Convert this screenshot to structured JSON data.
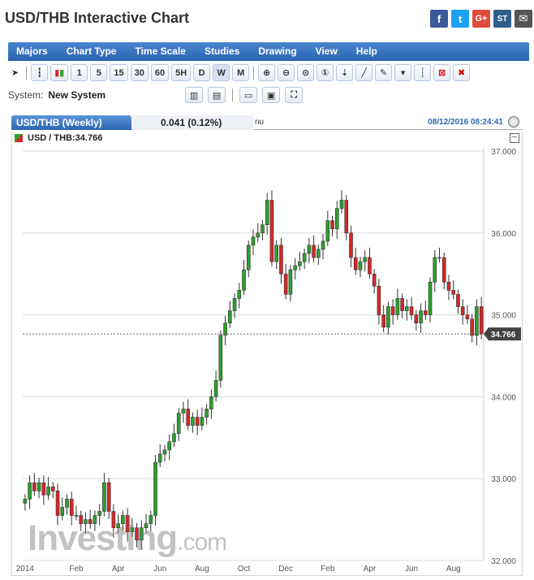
{
  "page": {
    "title": "USD/THB Interactive Chart",
    "share": [
      {
        "name": "facebook-icon",
        "glyph": "f",
        "cls": "fb"
      },
      {
        "name": "twitter-icon",
        "glyph": "t",
        "cls": "tw"
      },
      {
        "name": "google-plus-icon",
        "glyph": "G+",
        "cls": "gp"
      },
      {
        "name": "stocktwits-icon",
        "glyph": "ST",
        "cls": "st"
      },
      {
        "name": "mail-icon",
        "glyph": "✉",
        "cls": "ml"
      }
    ]
  },
  "menu": [
    "Majors",
    "Chart Type",
    "Time Scale",
    "Studies",
    "Drawing",
    "View",
    "Help"
  ],
  "toolbar": {
    "timeframes": [
      "1",
      "5",
      "15",
      "30",
      "60",
      "5H",
      "D",
      "W",
      "M"
    ],
    "active_timeframe": "W"
  },
  "system": {
    "label": "System:",
    "value": "New System"
  },
  "chart_header": {
    "tab": "USD/THB (Weekly)",
    "change": "0.041 (0.12%)",
    "extra": "nu",
    "timestamp": "08/12/2016 08:24:41",
    "legend": "USD / THB:34.766"
  },
  "watermark": {
    "brand": "Investing",
    "suffix": ".com"
  },
  "colors": {
    "up": "#2ca02c",
    "down": "#d62728",
    "grid": "#dcdcdc",
    "price_tag_bg": "#444444"
  },
  "chart_data": {
    "type": "candlestick",
    "title": "USD/THB (Weekly)",
    "ylim": [
      32.0,
      37.0
    ],
    "yticks": [
      "37.000",
      "36.000",
      "35.000",
      "34.000",
      "33.000",
      "32.000"
    ],
    "ytick_values": [
      37,
      36,
      35,
      34,
      33,
      32
    ],
    "xticks": [
      "2014",
      "Feb",
      "Apr",
      "Jun",
      "Aug",
      "Oct",
      "Dec",
      "Feb",
      "Apr",
      "Jun",
      "Aug"
    ],
    "xtick_index": [
      0,
      11,
      20,
      29,
      38,
      47,
      56,
      65,
      74,
      83,
      92
    ],
    "last_price": 34.766,
    "last_price_label": "34.766",
    "closes": [
      32.75,
      32.95,
      32.85,
      32.95,
      32.8,
      32.9,
      32.85,
      32.55,
      32.65,
      32.75,
      32.55,
      32.55,
      32.45,
      32.5,
      32.45,
      32.55,
      32.6,
      32.95,
      32.6,
      32.4,
      32.45,
      32.55,
      32.35,
      32.4,
      32.25,
      32.4,
      32.45,
      32.55,
      33.2,
      33.3,
      33.35,
      33.45,
      33.55,
      33.8,
      33.85,
      33.65,
      33.75,
      33.65,
      33.75,
      33.85,
      34.0,
      34.2,
      34.75,
      34.9,
      35.05,
      35.2,
      35.3,
      35.55,
      35.85,
      35.95,
      36.0,
      36.1,
      36.4,
      35.65,
      35.85,
      35.5,
      35.25,
      35.55,
      35.6,
      35.65,
      35.75,
      35.85,
      35.7,
      35.8,
      35.9,
      36.15,
      36.05,
      36.3,
      36.4,
      36.0,
      35.7,
      35.55,
      35.65,
      35.7,
      35.5,
      35.35,
      35.0,
      34.85,
      35.1,
      35.0,
      35.2,
      35.05,
      35.1,
      35.0,
      34.9,
      35.05,
      35.0,
      35.4,
      35.7,
      35.7,
      35.4,
      35.3,
      35.25,
      35.1,
      35.0,
      34.95,
      34.75,
      35.1,
      34.766
    ]
  }
}
